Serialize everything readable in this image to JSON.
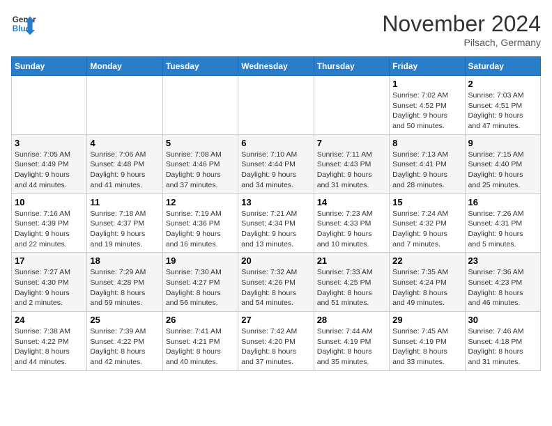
{
  "logo": {
    "line1": "General",
    "line2": "Blue"
  },
  "title": "November 2024",
  "location": "Pilsach, Germany",
  "days_of_week": [
    "Sunday",
    "Monday",
    "Tuesday",
    "Wednesday",
    "Thursday",
    "Friday",
    "Saturday"
  ],
  "weeks": [
    [
      {
        "day": "",
        "info": ""
      },
      {
        "day": "",
        "info": ""
      },
      {
        "day": "",
        "info": ""
      },
      {
        "day": "",
        "info": ""
      },
      {
        "day": "",
        "info": ""
      },
      {
        "day": "1",
        "info": "Sunrise: 7:02 AM\nSunset: 4:52 PM\nDaylight: 9 hours\nand 50 minutes."
      },
      {
        "day": "2",
        "info": "Sunrise: 7:03 AM\nSunset: 4:51 PM\nDaylight: 9 hours\nand 47 minutes."
      }
    ],
    [
      {
        "day": "3",
        "info": "Sunrise: 7:05 AM\nSunset: 4:49 PM\nDaylight: 9 hours\nand 44 minutes."
      },
      {
        "day": "4",
        "info": "Sunrise: 7:06 AM\nSunset: 4:48 PM\nDaylight: 9 hours\nand 41 minutes."
      },
      {
        "day": "5",
        "info": "Sunrise: 7:08 AM\nSunset: 4:46 PM\nDaylight: 9 hours\nand 37 minutes."
      },
      {
        "day": "6",
        "info": "Sunrise: 7:10 AM\nSunset: 4:44 PM\nDaylight: 9 hours\nand 34 minutes."
      },
      {
        "day": "7",
        "info": "Sunrise: 7:11 AM\nSunset: 4:43 PM\nDaylight: 9 hours\nand 31 minutes."
      },
      {
        "day": "8",
        "info": "Sunrise: 7:13 AM\nSunset: 4:41 PM\nDaylight: 9 hours\nand 28 minutes."
      },
      {
        "day": "9",
        "info": "Sunrise: 7:15 AM\nSunset: 4:40 PM\nDaylight: 9 hours\nand 25 minutes."
      }
    ],
    [
      {
        "day": "10",
        "info": "Sunrise: 7:16 AM\nSunset: 4:39 PM\nDaylight: 9 hours\nand 22 minutes."
      },
      {
        "day": "11",
        "info": "Sunrise: 7:18 AM\nSunset: 4:37 PM\nDaylight: 9 hours\nand 19 minutes."
      },
      {
        "day": "12",
        "info": "Sunrise: 7:19 AM\nSunset: 4:36 PM\nDaylight: 9 hours\nand 16 minutes."
      },
      {
        "day": "13",
        "info": "Sunrise: 7:21 AM\nSunset: 4:34 PM\nDaylight: 9 hours\nand 13 minutes."
      },
      {
        "day": "14",
        "info": "Sunrise: 7:23 AM\nSunset: 4:33 PM\nDaylight: 9 hours\nand 10 minutes."
      },
      {
        "day": "15",
        "info": "Sunrise: 7:24 AM\nSunset: 4:32 PM\nDaylight: 9 hours\nand 7 minutes."
      },
      {
        "day": "16",
        "info": "Sunrise: 7:26 AM\nSunset: 4:31 PM\nDaylight: 9 hours\nand 5 minutes."
      }
    ],
    [
      {
        "day": "17",
        "info": "Sunrise: 7:27 AM\nSunset: 4:30 PM\nDaylight: 9 hours\nand 2 minutes."
      },
      {
        "day": "18",
        "info": "Sunrise: 7:29 AM\nSunset: 4:28 PM\nDaylight: 8 hours\nand 59 minutes."
      },
      {
        "day": "19",
        "info": "Sunrise: 7:30 AM\nSunset: 4:27 PM\nDaylight: 8 hours\nand 56 minutes."
      },
      {
        "day": "20",
        "info": "Sunrise: 7:32 AM\nSunset: 4:26 PM\nDaylight: 8 hours\nand 54 minutes."
      },
      {
        "day": "21",
        "info": "Sunrise: 7:33 AM\nSunset: 4:25 PM\nDaylight: 8 hours\nand 51 minutes."
      },
      {
        "day": "22",
        "info": "Sunrise: 7:35 AM\nSunset: 4:24 PM\nDaylight: 8 hours\nand 49 minutes."
      },
      {
        "day": "23",
        "info": "Sunrise: 7:36 AM\nSunset: 4:23 PM\nDaylight: 8 hours\nand 46 minutes."
      }
    ],
    [
      {
        "day": "24",
        "info": "Sunrise: 7:38 AM\nSunset: 4:22 PM\nDaylight: 8 hours\nand 44 minutes."
      },
      {
        "day": "25",
        "info": "Sunrise: 7:39 AM\nSunset: 4:22 PM\nDaylight: 8 hours\nand 42 minutes."
      },
      {
        "day": "26",
        "info": "Sunrise: 7:41 AM\nSunset: 4:21 PM\nDaylight: 8 hours\nand 40 minutes."
      },
      {
        "day": "27",
        "info": "Sunrise: 7:42 AM\nSunset: 4:20 PM\nDaylight: 8 hours\nand 37 minutes."
      },
      {
        "day": "28",
        "info": "Sunrise: 7:44 AM\nSunset: 4:19 PM\nDaylight: 8 hours\nand 35 minutes."
      },
      {
        "day": "29",
        "info": "Sunrise: 7:45 AM\nSunset: 4:19 PM\nDaylight: 8 hours\nand 33 minutes."
      },
      {
        "day": "30",
        "info": "Sunrise: 7:46 AM\nSunset: 4:18 PM\nDaylight: 8 hours\nand 31 minutes."
      }
    ]
  ]
}
